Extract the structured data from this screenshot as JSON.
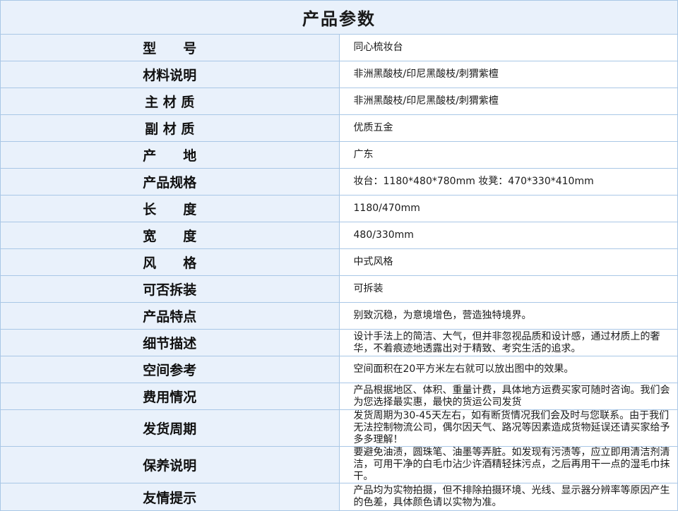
{
  "title": "产品参数",
  "rows": [
    {
      "label": "型　　号",
      "value": "同心梳妆台"
    },
    {
      "label": "材料说明",
      "value": "非洲黑酸枝/印尼黑酸枝/刺猬紫檀"
    },
    {
      "label": "主 材 质",
      "value": "非洲黑酸枝/印尼黑酸枝/刺猬紫檀"
    },
    {
      "label": "副 材 质",
      "value": "优质五金"
    },
    {
      "label": "产　　地",
      "value": "广东"
    },
    {
      "label": "产品规格",
      "value": "妆台：1180*480*780mm 妆凳：470*330*410mm"
    },
    {
      "label": "长　　度",
      "value": "1180/470mm"
    },
    {
      "label": "宽　　度",
      "value": "480/330mm"
    },
    {
      "label": "风　　格",
      "value": "中式风格"
    },
    {
      "label": "可否拆装",
      "value": "可拆装"
    },
    {
      "label": "产品特点",
      "value": "别致沉稳，为意境增色，营造独特境界。"
    },
    {
      "label": "细节描述",
      "value": "设计手法上的简洁、大气，但并非忽视品质和设计感，通过材质上的奢华，不着痕迹地透露出对于精致、考究生活的追求。"
    },
    {
      "label": "空间参考",
      "value": "空间面积在20平方米左右就可以放出图中的效果。"
    },
    {
      "label": "费用情况",
      "value": "产品根据地区、体积、重量计费，具体地方运费买家可随时咨询。我们会为您选择最实惠，最快的货运公司发货"
    },
    {
      "label": "发货周期",
      "value": "发货周期为30-45天左右，如有断货情况我们会及时与您联系。由于我们无法控制物流公司，偶尔因天气、路况等因素造成货物延误还请买家给予多多理解！"
    },
    {
      "label": "保养说明",
      "value": "要避免油渍，圆珠笔、油墨等弄脏。如发现有污渍等，应立即用清洁剂清洁，可用干净的白毛巾沾少许酒精轻抹污点，之后再用干一点的湿毛巾抹干。"
    },
    {
      "label": "友情提示",
      "value": "产品均为实物拍摄，但不排除拍摄环境、光线、显示器分辨率等原因产生的色差，具体颜色请以实物为准。"
    }
  ]
}
